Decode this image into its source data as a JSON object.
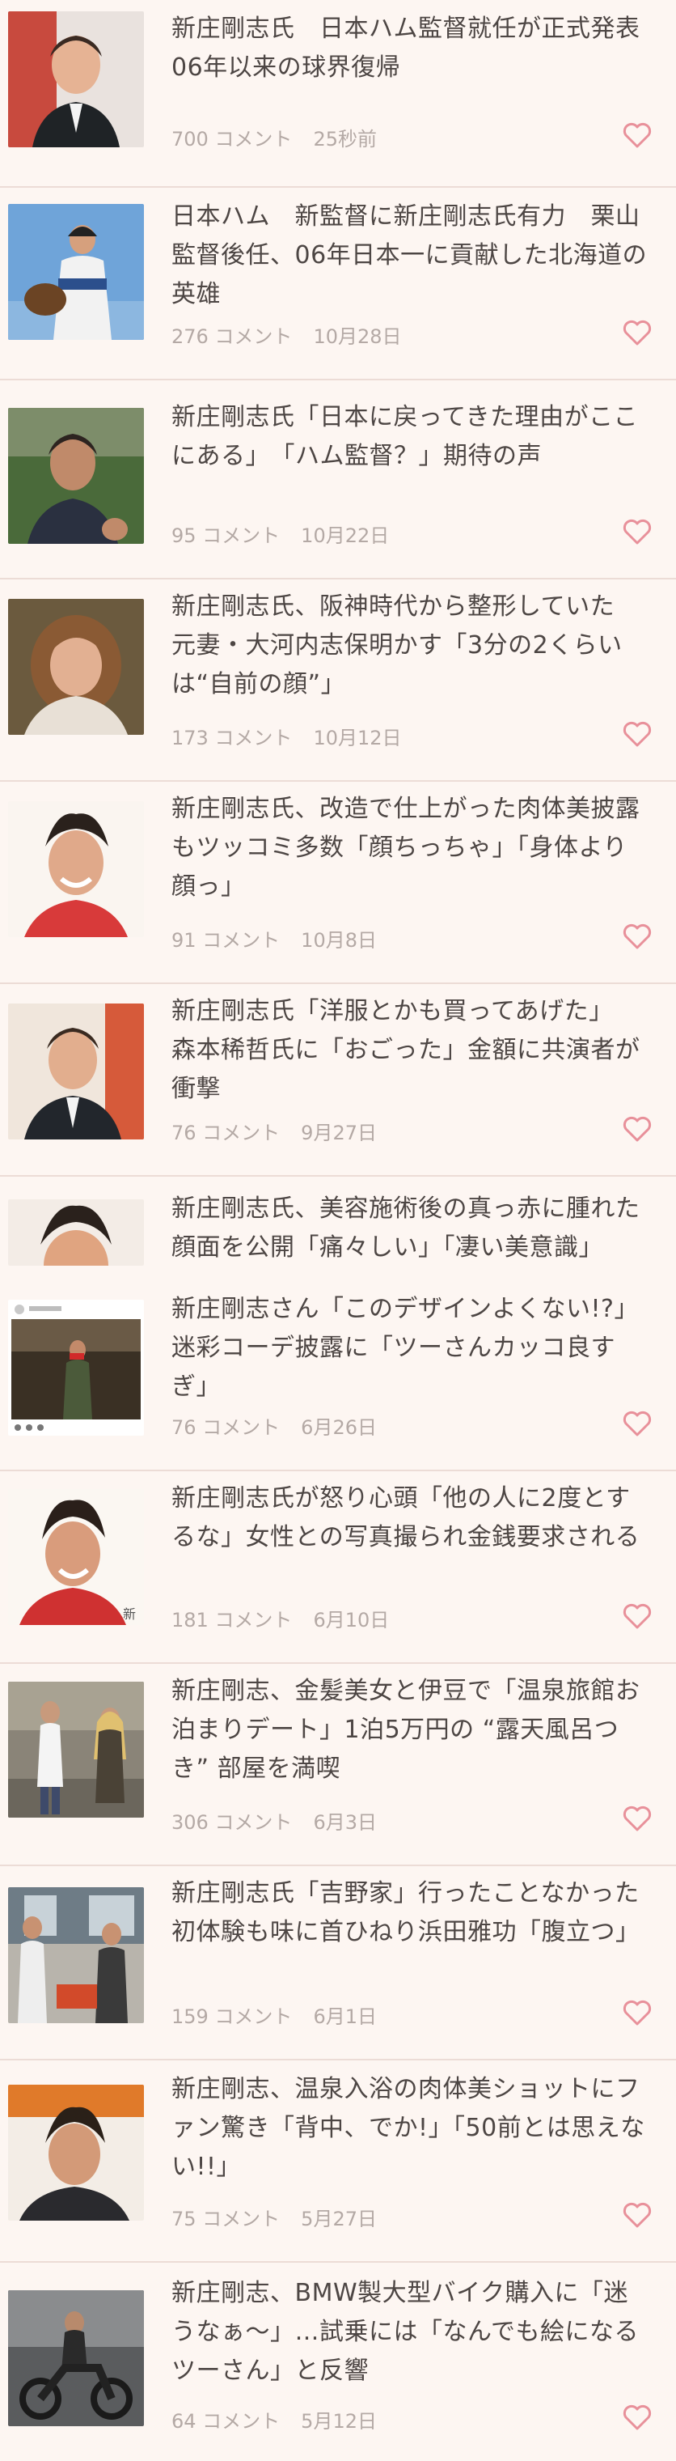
{
  "items": [
    {
      "title": "新庄剛志氏　日本ハム監督就任が正式発表　06年以来の球界復帰",
      "comments": "700 コメント",
      "date": "25秒前",
      "thumb_icon": "man-suit-photo"
    },
    {
      "title": "日本ハム　新監督に新庄剛志氏有力　栗山監督後任、06年日本一に貢献した北海道の英雄",
      "comments": "276 コメント",
      "date": "10月28日",
      "thumb_icon": "baseball-player-photo"
    },
    {
      "title": "新庄剛志氏「日本に戻ってきた理由がここにある」　「ハム監督？」期待の声",
      "comments": "95 コメント",
      "date": "10月22日",
      "thumb_icon": "man-portrait-photo"
    },
    {
      "title": "新庄剛志氏、阪神時代から整形していた　元妻・大河内志保明かす「3分の2くらいは“自前の顔”」",
      "comments": "173 コメント",
      "date": "10月12日",
      "thumb_icon": "woman-portrait-photo"
    },
    {
      "title": "新庄剛志氏、改造で仕上がった肉体美披露もツッコミ多数「顔ちっちゃ」「身体より顔っ」",
      "comments": "91 コメント",
      "date": "10月8日",
      "thumb_icon": "smiling-man-photo"
    },
    {
      "title": "新庄剛志氏「洋服とかも買ってあげた」　森本稀哲氏に「おごった」金額に共演者が衝撃",
      "comments": "76 コメント",
      "date": "9月27日",
      "thumb_icon": "man-suit-photo"
    },
    {
      "title": "新庄剛志氏、美容施術後の真っ赤に腫れた顔面を公開「痛々しい」「凄い美意識」",
      "title2": "新庄剛志さん「このデザインよくない!?」迷彩コーデ披露に「ツーさんカッコ良すぎ」",
      "comments": "76 コメント",
      "date": "6月26日",
      "thumb_icon": "man-face-photo",
      "thumb2_icon": "instagram-post-photo"
    },
    {
      "title": "新庄剛志氏が怒り心頭「他の人に2度とするな」女性との写真撮られ金銭要求される",
      "comments": "181 コメント",
      "date": "6月10日",
      "thumb_icon": "smiling-man-photo"
    },
    {
      "title": "新庄剛志、金髪美女と伊豆で「温泉旅館お泊まりデート」1泊5万円の “露天風呂つき” 部屋を満喫",
      "comments": "306 コメント",
      "date": "6月3日",
      "thumb_icon": "street-snapshot-photo"
    },
    {
      "title": "新庄剛志氏「吉野家」行ったことなかった　初体験も味に首ひねり浜田雅功「腹立つ」",
      "comments": "159 コメント",
      "date": "6月1日",
      "thumb_icon": "tv-scene-photo"
    },
    {
      "title": "新庄剛志、温泉入浴の肉体美ショットにファン驚き「背中、でか!」「50前とは思えない!!」",
      "comments": "75 コメント",
      "date": "5月27日",
      "thumb_icon": "man-portrait-photo"
    },
    {
      "title": "新庄剛志、BMW製大型バイク購入に「迷うなぁ～」…試乗には「なんでも絵になるツーさん」と反響",
      "comments": "64 コメント",
      "date": "5月12日",
      "thumb_icon": "motorcycle-photo"
    }
  ],
  "colors": {
    "heart": "#e8909a",
    "meta": "#b4a9a5",
    "title": "#4d4644",
    "background": "#fdf6f2"
  }
}
